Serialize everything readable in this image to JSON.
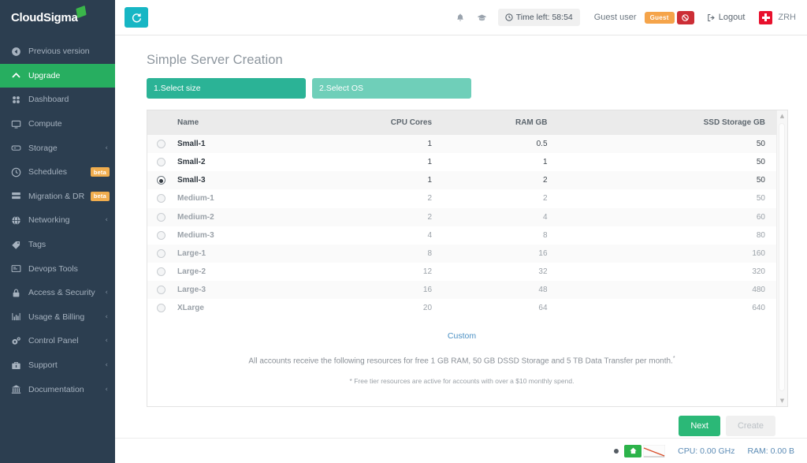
{
  "brand": {
    "name": "CloudSigma",
    "logo_icon": "sigma-diamond-icon",
    "accent_green": "#27ae60",
    "sidebar_bg": "#2c3e50"
  },
  "sidebar": {
    "items": [
      {
        "label": "Previous version",
        "icon": "back-circle-icon",
        "chevron": "",
        "badge": "",
        "active": false
      },
      {
        "label": "Upgrade",
        "icon": "chevron-up-icon",
        "chevron": "",
        "badge": "",
        "active": true
      },
      {
        "label": "Dashboard",
        "icon": "dashboard-icon",
        "chevron": "",
        "badge": "",
        "active": false
      },
      {
        "label": "Compute",
        "icon": "monitor-icon",
        "chevron": "",
        "badge": "",
        "active": false
      },
      {
        "label": "Storage",
        "icon": "storage-icon",
        "chevron": "‹",
        "badge": "",
        "active": false
      },
      {
        "label": "Schedules",
        "icon": "clock-icon",
        "chevron": "",
        "badge": "beta",
        "active": false
      },
      {
        "label": "Migration & DR",
        "icon": "servers-icon",
        "chevron": "",
        "badge": "beta",
        "active": false
      },
      {
        "label": "Networking",
        "icon": "globe-icon",
        "chevron": "‹",
        "badge": "",
        "active": false
      },
      {
        "label": "Tags",
        "icon": "tag-icon",
        "chevron": "",
        "badge": "",
        "active": false
      },
      {
        "label": "Devops Tools",
        "icon": "terminal-icon",
        "chevron": "",
        "badge": "",
        "active": false
      },
      {
        "label": "Access & Security",
        "icon": "lock-icon",
        "chevron": "‹",
        "badge": "",
        "active": false
      },
      {
        "label": "Usage & Billing",
        "icon": "bar-chart-icon",
        "chevron": "‹",
        "badge": "",
        "active": false
      },
      {
        "label": "Control Panel",
        "icon": "gears-icon",
        "chevron": "‹",
        "badge": "",
        "active": false
      },
      {
        "label": "Support",
        "icon": "lifebuoy-icon",
        "chevron": "‹",
        "badge": "",
        "active": false
      },
      {
        "label": "Documentation",
        "icon": "bank-icon",
        "chevron": "‹",
        "badge": "",
        "active": false
      }
    ]
  },
  "topbar": {
    "refresh_icon": "refresh-icon",
    "bell_icon": "bell-icon",
    "graduation_icon": "graduation-cap-icon",
    "time_icon": "clock-icon",
    "time_left": "Time left: 58:54",
    "user_label": "Guest user",
    "guest_badge": "Guest",
    "block_icon": "ban-icon",
    "logout_icon": "logout-icon",
    "logout_label": "Logout",
    "region_flag_icon": "swiss-flag-icon",
    "region": "ZRH"
  },
  "main": {
    "page_title": "Simple Server Creation",
    "tabs": [
      {
        "label": "1.Select size",
        "selected": true
      },
      {
        "label": "2.Select OS",
        "selected": false
      }
    ],
    "table": {
      "columns": [
        "Name",
        "CPU Cores",
        "RAM GB",
        "SSD Storage GB"
      ],
      "rows": [
        {
          "selected": false,
          "available": true,
          "name": "Small-1",
          "cpu": "1",
          "ram": "0.5",
          "ssd": "50"
        },
        {
          "selected": false,
          "available": true,
          "name": "Small-2",
          "cpu": "1",
          "ram": "1",
          "ssd": "50"
        },
        {
          "selected": true,
          "available": true,
          "name": "Small-3",
          "cpu": "1",
          "ram": "2",
          "ssd": "50"
        },
        {
          "selected": false,
          "available": false,
          "name": "Medium-1",
          "cpu": "2",
          "ram": "2",
          "ssd": "50"
        },
        {
          "selected": false,
          "available": false,
          "name": "Medium-2",
          "cpu": "2",
          "ram": "4",
          "ssd": "60"
        },
        {
          "selected": false,
          "available": false,
          "name": "Medium-3",
          "cpu": "4",
          "ram": "8",
          "ssd": "80"
        },
        {
          "selected": false,
          "available": false,
          "name": "Large-1",
          "cpu": "8",
          "ram": "16",
          "ssd": "160"
        },
        {
          "selected": false,
          "available": false,
          "name": "Large-2",
          "cpu": "12",
          "ram": "32",
          "ssd": "320"
        },
        {
          "selected": false,
          "available": false,
          "name": "Large-3",
          "cpu": "16",
          "ram": "48",
          "ssd": "480"
        },
        {
          "selected": false,
          "available": false,
          "name": "XLarge",
          "cpu": "20",
          "ram": "64",
          "ssd": "640"
        }
      ]
    },
    "custom_link": "Custom",
    "note_main": "All accounts receive the following resources for free 1 GB RAM, 50 GB DSSD Storage and 5 TB Data Transfer per month.",
    "note_main_sup": "*",
    "note_fine": "* Free tier resources are active for accounts with over a $10 monthly spend.",
    "buttons": {
      "next": "Next",
      "create": "Create"
    }
  },
  "footer": {
    "status_dot_icon": "status-dot-icon",
    "home_icon": "home-icon",
    "chart_icon": "sparkline-icon",
    "cpu": "CPU: 0.00 GHz",
    "ram": "RAM: 0.00 B"
  }
}
